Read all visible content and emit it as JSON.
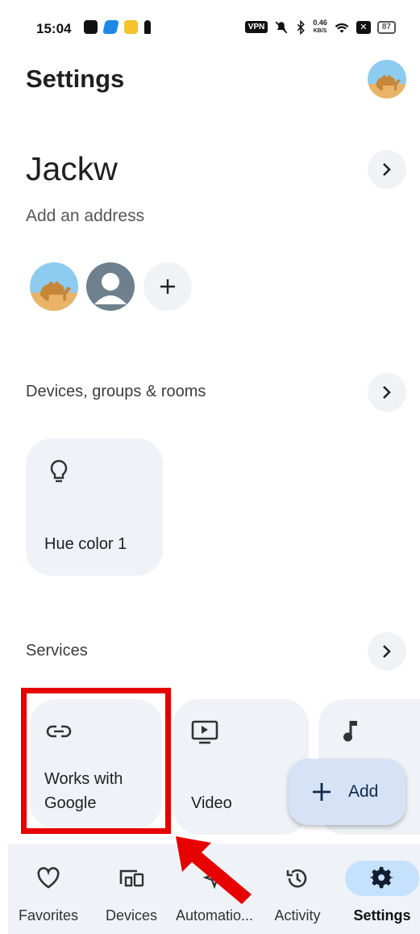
{
  "status_bar": {
    "time": "15:04",
    "vpn": "VPN",
    "speed_value": "0.46",
    "speed_unit": "KB/S",
    "battery": "87"
  },
  "header": {
    "title": "Settings"
  },
  "home": {
    "name": "Jackw",
    "address_prompt": "Add an address"
  },
  "sections": {
    "devices_label": "Devices, groups & rooms",
    "services_label": "Services"
  },
  "devices": [
    {
      "label": "Hue color 1",
      "icon": "lightbulb-icon"
    }
  ],
  "services": [
    {
      "label": "Works with\nGoogle",
      "icon": "link-icon"
    },
    {
      "label": "Video",
      "icon": "video-icon"
    },
    {
      "label": "",
      "icon": "music-note-icon"
    }
  ],
  "fab": {
    "label": "Add"
  },
  "nav": [
    {
      "label": "Favorites",
      "icon": "heart-icon"
    },
    {
      "label": "Devices",
      "icon": "devices-icon"
    },
    {
      "label": "Automatio...",
      "icon": "automation-icon"
    },
    {
      "label": "Activity",
      "icon": "history-icon"
    },
    {
      "label": "Settings",
      "icon": "gear-icon",
      "active": true
    }
  ],
  "colors": {
    "highlight": "#e60000",
    "card_bg": "#eff2f7",
    "active_nav": "#c6e1fb",
    "fab_bg": "#d6e3f7"
  }
}
